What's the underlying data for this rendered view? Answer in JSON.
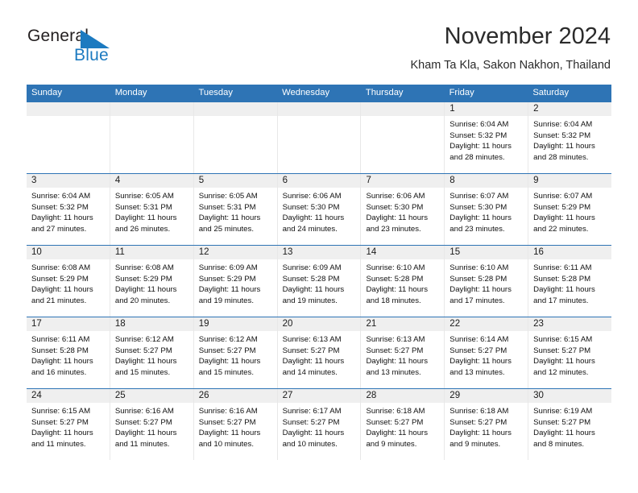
{
  "brand": {
    "name_top": "General",
    "name_bottom": "Blue",
    "color_primary": "#2e74b5",
    "color_text": "#231f20"
  },
  "header": {
    "title": "November 2024",
    "subtitle": "Kham Ta Kla, Sakon Nakhon, Thailand"
  },
  "calendar": {
    "weekdays": [
      "Sunday",
      "Monday",
      "Tuesday",
      "Wednesday",
      "Thursday",
      "Friday",
      "Saturday"
    ],
    "header_bg": "#2e74b5",
    "daynum_bg": "#efefef",
    "weeks": [
      [
        {
          "day": "",
          "sunrise": "",
          "sunset": "",
          "daylight_line1": "",
          "daylight_line2": ""
        },
        {
          "day": "",
          "sunrise": "",
          "sunset": "",
          "daylight_line1": "",
          "daylight_line2": ""
        },
        {
          "day": "",
          "sunrise": "",
          "sunset": "",
          "daylight_line1": "",
          "daylight_line2": ""
        },
        {
          "day": "",
          "sunrise": "",
          "sunset": "",
          "daylight_line1": "",
          "daylight_line2": ""
        },
        {
          "day": "",
          "sunrise": "",
          "sunset": "",
          "daylight_line1": "",
          "daylight_line2": ""
        },
        {
          "day": "1",
          "sunrise": "Sunrise: 6:04 AM",
          "sunset": "Sunset: 5:32 PM",
          "daylight_line1": "Daylight: 11 hours",
          "daylight_line2": "and 28 minutes."
        },
        {
          "day": "2",
          "sunrise": "Sunrise: 6:04 AM",
          "sunset": "Sunset: 5:32 PM",
          "daylight_line1": "Daylight: 11 hours",
          "daylight_line2": "and 28 minutes."
        }
      ],
      [
        {
          "day": "3",
          "sunrise": "Sunrise: 6:04 AM",
          "sunset": "Sunset: 5:32 PM",
          "daylight_line1": "Daylight: 11 hours",
          "daylight_line2": "and 27 minutes."
        },
        {
          "day": "4",
          "sunrise": "Sunrise: 6:05 AM",
          "sunset": "Sunset: 5:31 PM",
          "daylight_line1": "Daylight: 11 hours",
          "daylight_line2": "and 26 minutes."
        },
        {
          "day": "5",
          "sunrise": "Sunrise: 6:05 AM",
          "sunset": "Sunset: 5:31 PM",
          "daylight_line1": "Daylight: 11 hours",
          "daylight_line2": "and 25 minutes."
        },
        {
          "day": "6",
          "sunrise": "Sunrise: 6:06 AM",
          "sunset": "Sunset: 5:30 PM",
          "daylight_line1": "Daylight: 11 hours",
          "daylight_line2": "and 24 minutes."
        },
        {
          "day": "7",
          "sunrise": "Sunrise: 6:06 AM",
          "sunset": "Sunset: 5:30 PM",
          "daylight_line1": "Daylight: 11 hours",
          "daylight_line2": "and 23 minutes."
        },
        {
          "day": "8",
          "sunrise": "Sunrise: 6:07 AM",
          "sunset": "Sunset: 5:30 PM",
          "daylight_line1": "Daylight: 11 hours",
          "daylight_line2": "and 23 minutes."
        },
        {
          "day": "9",
          "sunrise": "Sunrise: 6:07 AM",
          "sunset": "Sunset: 5:29 PM",
          "daylight_line1": "Daylight: 11 hours",
          "daylight_line2": "and 22 minutes."
        }
      ],
      [
        {
          "day": "10",
          "sunrise": "Sunrise: 6:08 AM",
          "sunset": "Sunset: 5:29 PM",
          "daylight_line1": "Daylight: 11 hours",
          "daylight_line2": "and 21 minutes."
        },
        {
          "day": "11",
          "sunrise": "Sunrise: 6:08 AM",
          "sunset": "Sunset: 5:29 PM",
          "daylight_line1": "Daylight: 11 hours",
          "daylight_line2": "and 20 minutes."
        },
        {
          "day": "12",
          "sunrise": "Sunrise: 6:09 AM",
          "sunset": "Sunset: 5:29 PM",
          "daylight_line1": "Daylight: 11 hours",
          "daylight_line2": "and 19 minutes."
        },
        {
          "day": "13",
          "sunrise": "Sunrise: 6:09 AM",
          "sunset": "Sunset: 5:28 PM",
          "daylight_line1": "Daylight: 11 hours",
          "daylight_line2": "and 19 minutes."
        },
        {
          "day": "14",
          "sunrise": "Sunrise: 6:10 AM",
          "sunset": "Sunset: 5:28 PM",
          "daylight_line1": "Daylight: 11 hours",
          "daylight_line2": "and 18 minutes."
        },
        {
          "day": "15",
          "sunrise": "Sunrise: 6:10 AM",
          "sunset": "Sunset: 5:28 PM",
          "daylight_line1": "Daylight: 11 hours",
          "daylight_line2": "and 17 minutes."
        },
        {
          "day": "16",
          "sunrise": "Sunrise: 6:11 AM",
          "sunset": "Sunset: 5:28 PM",
          "daylight_line1": "Daylight: 11 hours",
          "daylight_line2": "and 17 minutes."
        }
      ],
      [
        {
          "day": "17",
          "sunrise": "Sunrise: 6:11 AM",
          "sunset": "Sunset: 5:28 PM",
          "daylight_line1": "Daylight: 11 hours",
          "daylight_line2": "and 16 minutes."
        },
        {
          "day": "18",
          "sunrise": "Sunrise: 6:12 AM",
          "sunset": "Sunset: 5:27 PM",
          "daylight_line1": "Daylight: 11 hours",
          "daylight_line2": "and 15 minutes."
        },
        {
          "day": "19",
          "sunrise": "Sunrise: 6:12 AM",
          "sunset": "Sunset: 5:27 PM",
          "daylight_line1": "Daylight: 11 hours",
          "daylight_line2": "and 15 minutes."
        },
        {
          "day": "20",
          "sunrise": "Sunrise: 6:13 AM",
          "sunset": "Sunset: 5:27 PM",
          "daylight_line1": "Daylight: 11 hours",
          "daylight_line2": "and 14 minutes."
        },
        {
          "day": "21",
          "sunrise": "Sunrise: 6:13 AM",
          "sunset": "Sunset: 5:27 PM",
          "daylight_line1": "Daylight: 11 hours",
          "daylight_line2": "and 13 minutes."
        },
        {
          "day": "22",
          "sunrise": "Sunrise: 6:14 AM",
          "sunset": "Sunset: 5:27 PM",
          "daylight_line1": "Daylight: 11 hours",
          "daylight_line2": "and 13 minutes."
        },
        {
          "day": "23",
          "sunrise": "Sunrise: 6:15 AM",
          "sunset": "Sunset: 5:27 PM",
          "daylight_line1": "Daylight: 11 hours",
          "daylight_line2": "and 12 minutes."
        }
      ],
      [
        {
          "day": "24",
          "sunrise": "Sunrise: 6:15 AM",
          "sunset": "Sunset: 5:27 PM",
          "daylight_line1": "Daylight: 11 hours",
          "daylight_line2": "and 11 minutes."
        },
        {
          "day": "25",
          "sunrise": "Sunrise: 6:16 AM",
          "sunset": "Sunset: 5:27 PM",
          "daylight_line1": "Daylight: 11 hours",
          "daylight_line2": "and 11 minutes."
        },
        {
          "day": "26",
          "sunrise": "Sunrise: 6:16 AM",
          "sunset": "Sunset: 5:27 PM",
          "daylight_line1": "Daylight: 11 hours",
          "daylight_line2": "and 10 minutes."
        },
        {
          "day": "27",
          "sunrise": "Sunrise: 6:17 AM",
          "sunset": "Sunset: 5:27 PM",
          "daylight_line1": "Daylight: 11 hours",
          "daylight_line2": "and 10 minutes."
        },
        {
          "day": "28",
          "sunrise": "Sunrise: 6:18 AM",
          "sunset": "Sunset: 5:27 PM",
          "daylight_line1": "Daylight: 11 hours",
          "daylight_line2": "and 9 minutes."
        },
        {
          "day": "29",
          "sunrise": "Sunrise: 6:18 AM",
          "sunset": "Sunset: 5:27 PM",
          "daylight_line1": "Daylight: 11 hours",
          "daylight_line2": "and 9 minutes."
        },
        {
          "day": "30",
          "sunrise": "Sunrise: 6:19 AM",
          "sunset": "Sunset: 5:27 PM",
          "daylight_line1": "Daylight: 11 hours",
          "daylight_line2": "and 8 minutes."
        }
      ]
    ]
  }
}
